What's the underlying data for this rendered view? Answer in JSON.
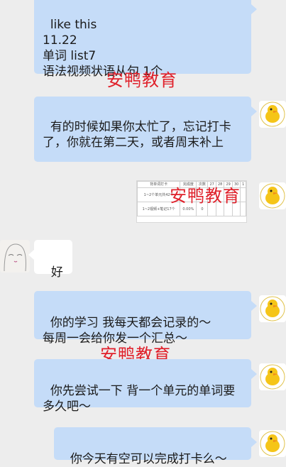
{
  "messages": {
    "m1": "like this\n11.22\n单词 list7\n语法视频状语从句 1个",
    "m2": "有的时候如果你太忙了，忘记打卡了，你就在第二天，或者周末补上",
    "m3": "好",
    "m4": "你的学习 我每天都会记录的～\n每周一会给你发一个汇总～",
    "m5": "你先尝试一下 背一个单元的单词要多久吧～",
    "m6": "你今天有空可以完成打卡么～"
  },
  "watermark": "安鸭教育",
  "table_image": {
    "headers": [
      "背单词打卡",
      "完成度",
      "次数",
      "27",
      "28",
      "29",
      "30",
      "1"
    ],
    "rows": [
      [
        "1~2个单元共42个",
        "",
        "",
        "",
        "",
        "",
        "",
        ""
      ],
      [
        "1~2视频+笔记17个",
        "0.00%",
        "0",
        "",
        "",
        "",
        "",
        ""
      ]
    ]
  },
  "colors": {
    "background": "#ededed",
    "sent_bubble": "#c5dcf8",
    "received_bubble": "#ffffff",
    "watermark": "#e0202a"
  },
  "avatars": {
    "self": "duck-logo-avatar",
    "contact": "sketch-portrait-avatar"
  }
}
